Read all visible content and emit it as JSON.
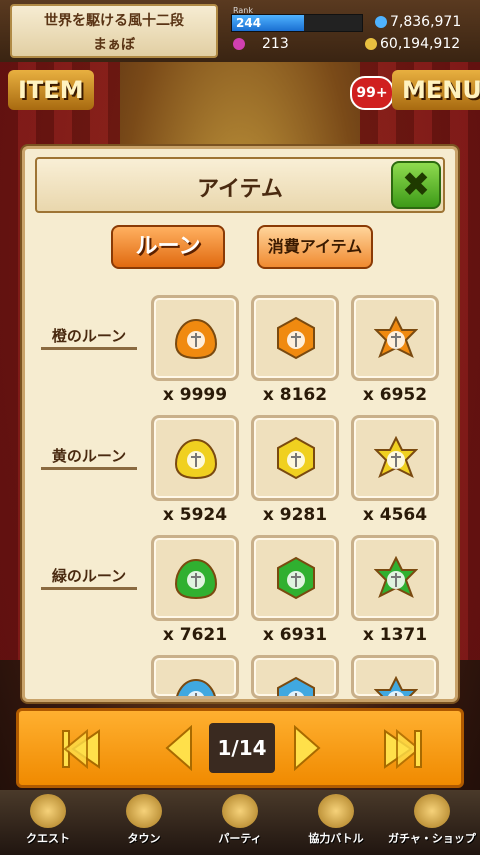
{
  "guild": {
    "name": "世界を駆ける風十二段",
    "player": "まぁぼ"
  },
  "status": {
    "rank_label": "Rank",
    "rank": "244",
    "rank_progress": 0.55,
    "gold": "7,836,971",
    "gems": "213",
    "coins": "60,194,912"
  },
  "bg_buttons": {
    "item": "ITEM",
    "menu": "MENU",
    "badge": "99+"
  },
  "dialog": {
    "title": "アイテム",
    "tabs": [
      "ルーン",
      "消費アイテム"
    ],
    "rows": [
      {
        "label": "橙のルーン",
        "color": "#f08a10",
        "qty": [
          "x 9999",
          "x 8162",
          "x 6952"
        ]
      },
      {
        "label": "黄のルーン",
        "color": "#f0d020",
        "qty": [
          "x 5924",
          "x 9281",
          "x 4564"
        ]
      },
      {
        "label": "緑のルーン",
        "color": "#30b030",
        "qty": [
          "x 7621",
          "x 6931",
          "x 1371"
        ]
      }
    ],
    "partial_row_color": "#40a8e0",
    "gem_shapes": [
      "drop-rune-icon",
      "hexagon-rune-icon",
      "star-rune-icon"
    ]
  },
  "pager": {
    "page": "1/14"
  },
  "bottom_nav": [
    "クエスト",
    "タウン",
    "パーティ",
    "協力バトル",
    "ガチャ・ショップ"
  ]
}
